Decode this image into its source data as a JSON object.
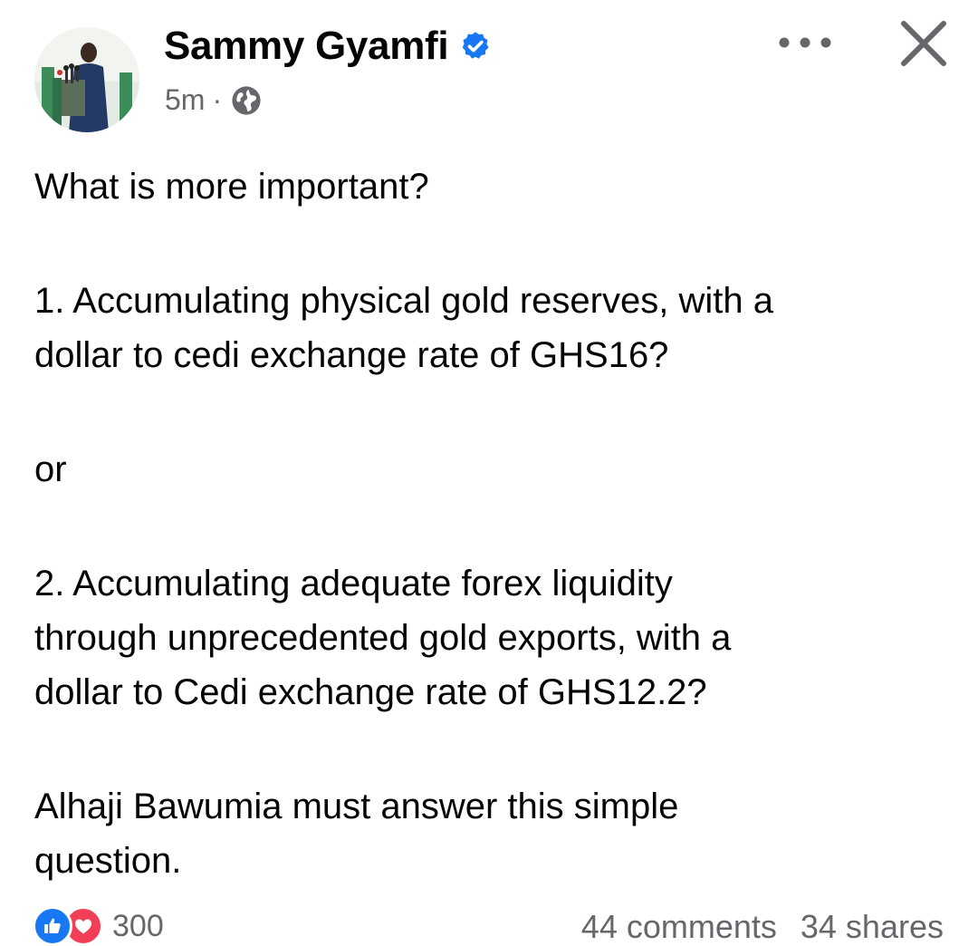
{
  "post": {
    "author": "Sammy Gyamfi",
    "verified": true,
    "time": "5m",
    "separator": "·",
    "audience_icon": "globe-icon",
    "paragraphs": [
      [
        "What is more important?"
      ],
      [
        "1. Accumulating physical gold reserves, with a",
        "dollar to cedi exchange rate of GHS16?"
      ],
      [
        "or"
      ],
      [
        "2. Accumulating adequate forex liquidity",
        "through unprecedented gold exports, with a",
        "dollar to Cedi exchange rate of GHS12.2?"
      ],
      [
        "Alhaji Bawumia must answer this simple",
        "question."
      ]
    ]
  },
  "engagement": {
    "reaction_icons": [
      "like-icon",
      "love-icon"
    ],
    "reaction_count": "300",
    "comments": "44 comments",
    "shares": "34 shares"
  },
  "colors": {
    "text": "#050505",
    "secondary": "#65676b",
    "verified_badge": "#1877f2",
    "like": "#1877f2",
    "love": "#f33e58"
  }
}
